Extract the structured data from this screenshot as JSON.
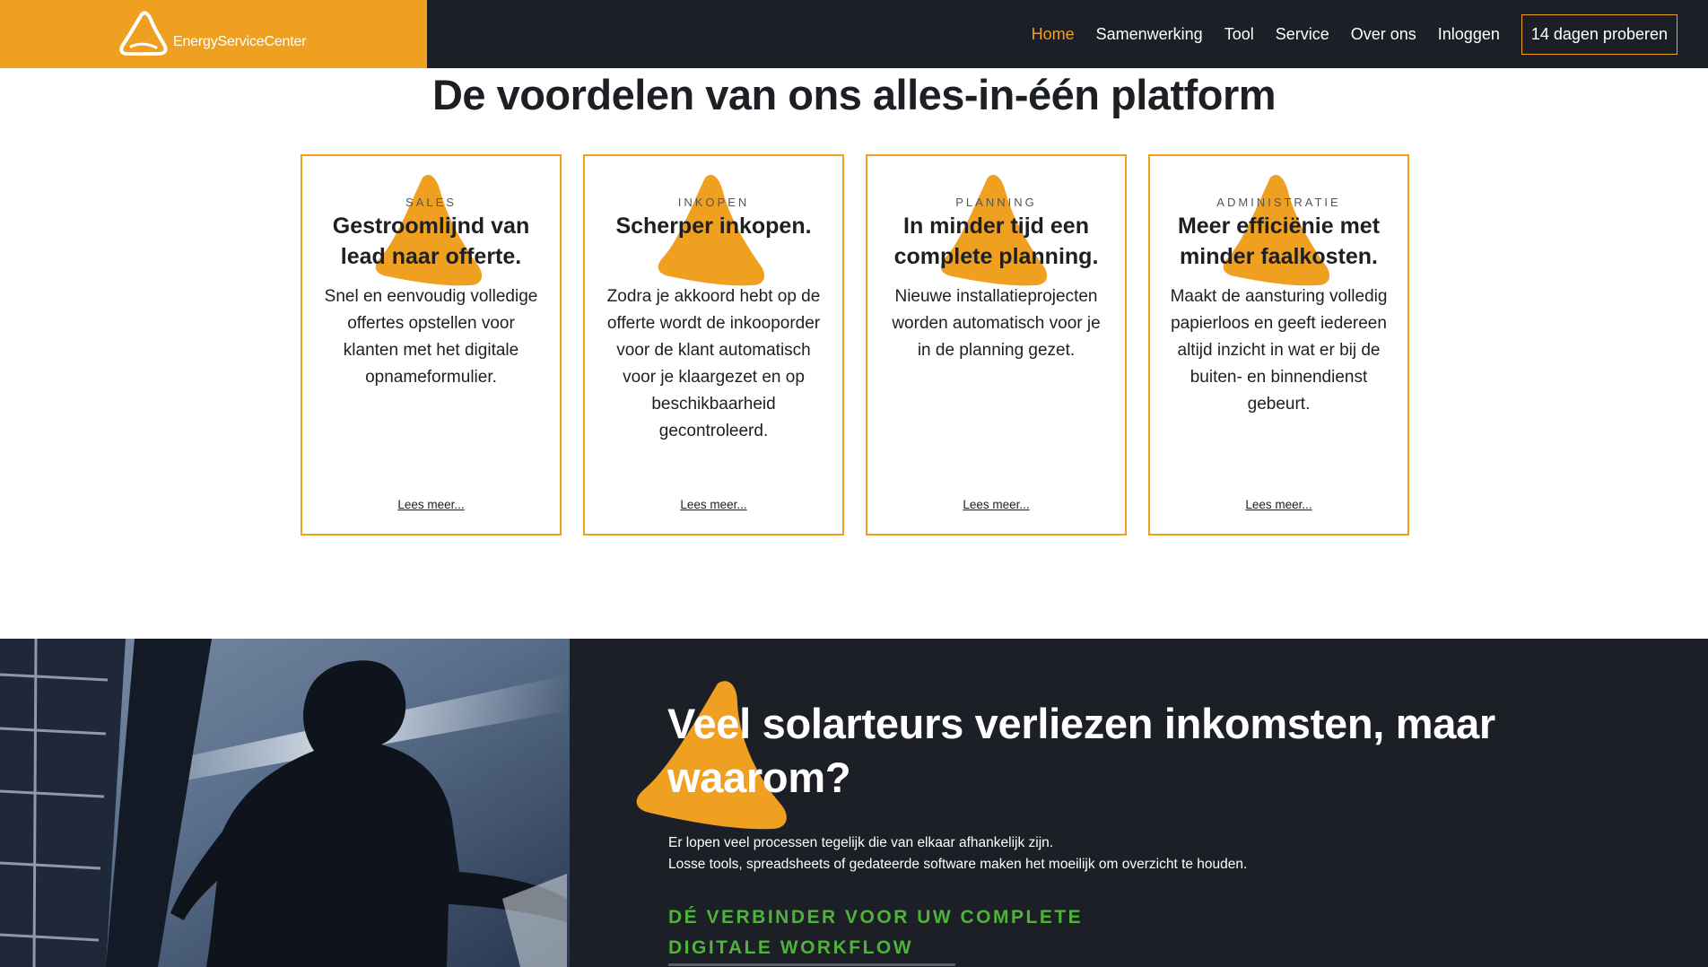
{
  "header": {
    "logo_text": "EnergyServiceCenter",
    "nav": [
      {
        "label": "Home",
        "active": true
      },
      {
        "label": "Samenwerking",
        "active": false
      },
      {
        "label": "Tool",
        "active": false
      },
      {
        "label": "Service",
        "active": false
      },
      {
        "label": "Over ons",
        "active": false
      },
      {
        "label": "Inloggen",
        "active": false
      }
    ],
    "cta_label": "14 dagen proberen"
  },
  "benefits": {
    "title": "De voordelen van ons alles-in-één platform",
    "cards": [
      {
        "eyebrow": "SALES",
        "title": "Gestroomlijnd van lead naar offerte.",
        "body": "Snel en eenvoudig volledige offertes opstellen voor klanten met het digitale opnameformulier.",
        "link": "Lees meer..."
      },
      {
        "eyebrow": "INKOPEN",
        "title": "Scherper inkopen.",
        "body": "Zodra je akkoord hebt op de offerte wordt de inkooporder voor de klant automatisch voor je klaargezet en op beschikbaarheid gecontroleerd.",
        "link": "Lees meer..."
      },
      {
        "eyebrow": "PLANNING",
        "title": "In minder tijd een complete planning.",
        "body": "Nieuwe installatieprojecten worden automatisch voor je in de planning gezet.",
        "link": "Lees meer..."
      },
      {
        "eyebrow": "ADMINISTRATIE",
        "title": "Meer efficiënie met minder faalkosten.",
        "body": "Maakt de aansturing volledig papierloos en geeft iedereen altijd inzicht in wat er bij de buiten- en binnendienst gebeurt.",
        "link": "Lees meer..."
      }
    ]
  },
  "problem": {
    "title": "Veel solarteurs verliezen inkomsten, maar waarom?",
    "line1": "Er lopen veel processen tegelijk die van elkaar afhankelijk zijn.",
    "line2": "Losse tools, spreadsheets of gedateerde software maken het moeilijk om overzicht te houden.",
    "subheading": "DÉ VERBINDER VOOR UW COMPLETE DIGITALE WORKFLOW"
  },
  "colors": {
    "accent": "#f0a021",
    "dark": "#1c1f26",
    "green": "#4fb23a",
    "white": "#ffffff"
  },
  "icons": {
    "logo": "triangle-logo-icon",
    "card_decoration": "orange-triangle-blob-icon"
  }
}
